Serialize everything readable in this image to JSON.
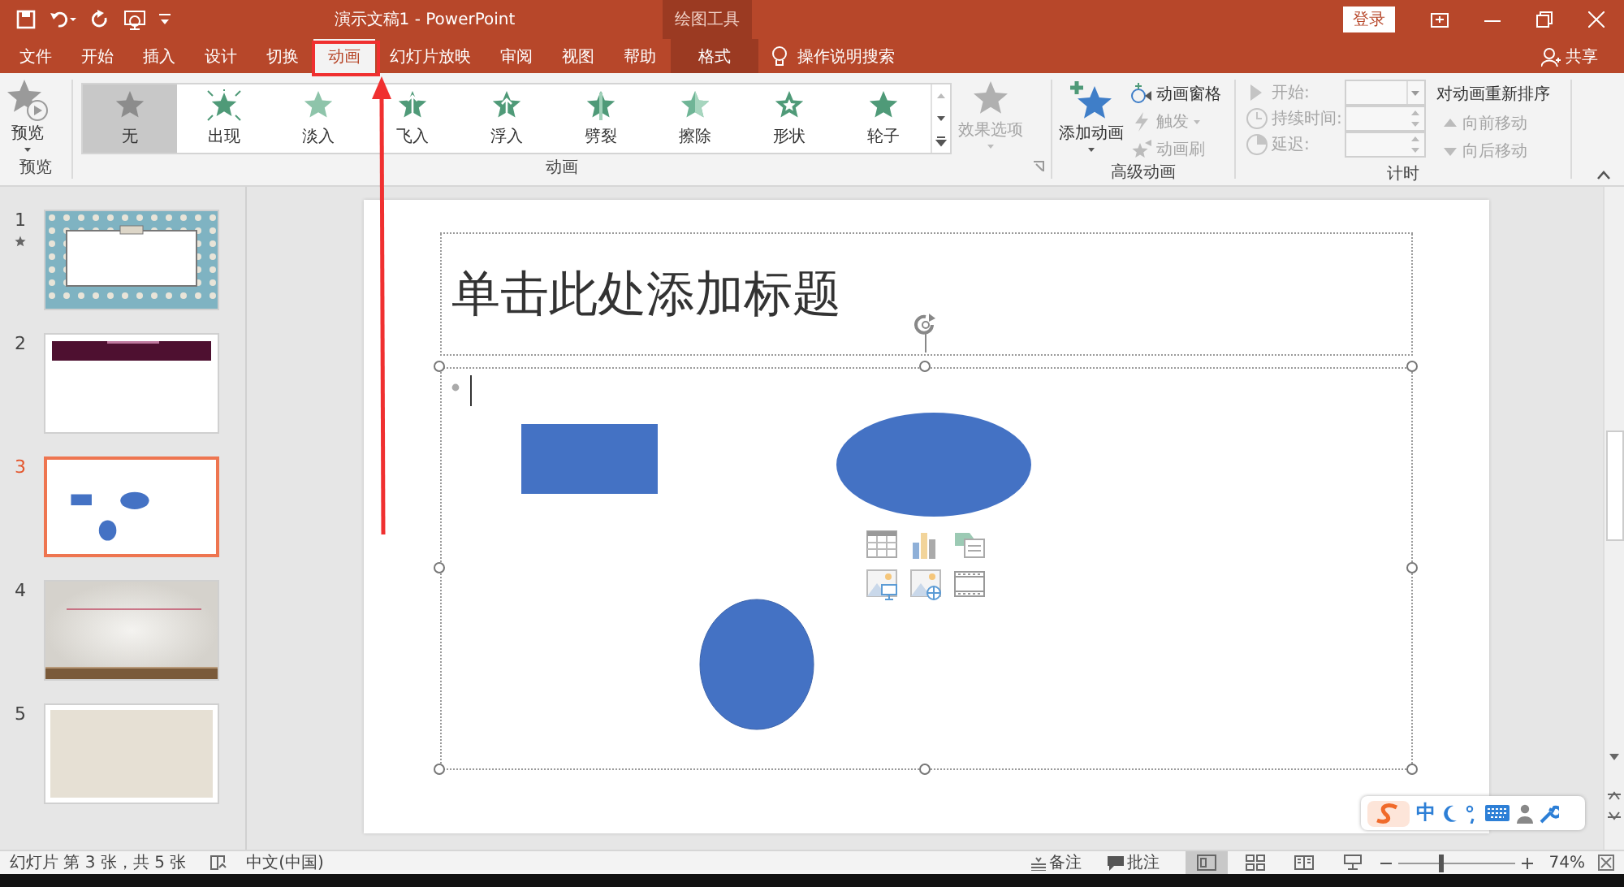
{
  "window": {
    "title": "演示文稿1  -  PowerPoint",
    "context_label": "绘图工具",
    "login": "登录"
  },
  "tabs": [
    {
      "label": "文件",
      "selected": false,
      "kind": "standard"
    },
    {
      "label": "开始",
      "selected": false,
      "kind": "standard"
    },
    {
      "label": "插入",
      "selected": false,
      "kind": "standard"
    },
    {
      "label": "设计",
      "selected": false,
      "kind": "standard"
    },
    {
      "label": "切换",
      "selected": false,
      "kind": "standard"
    },
    {
      "label": "动画",
      "selected": true,
      "kind": "standard"
    },
    {
      "label": "幻灯片放映",
      "selected": false,
      "kind": "standard"
    },
    {
      "label": "审阅",
      "selected": false,
      "kind": "standard"
    },
    {
      "label": "视图",
      "selected": false,
      "kind": "standard"
    },
    {
      "label": "帮助",
      "selected": false,
      "kind": "standard"
    },
    {
      "label": "格式",
      "selected": false,
      "kind": "contextual"
    }
  ],
  "tell_me": "操作说明搜索",
  "share": "共享",
  "ribbon": {
    "preview": {
      "label": "预览",
      "group_label": "预览"
    },
    "animations": {
      "items": [
        {
          "label": "无",
          "selected": true,
          "kind": "none"
        },
        {
          "label": "出现",
          "selected": false,
          "kind": "appear"
        },
        {
          "label": "淡入",
          "selected": false,
          "kind": "fade"
        },
        {
          "label": "飞入",
          "selected": false,
          "kind": "fly"
        },
        {
          "label": "浮入",
          "selected": false,
          "kind": "float"
        },
        {
          "label": "劈裂",
          "selected": false,
          "kind": "split"
        },
        {
          "label": "擦除",
          "selected": false,
          "kind": "wipe"
        },
        {
          "label": "形状",
          "selected": false,
          "kind": "shape"
        },
        {
          "label": "轮子",
          "selected": false,
          "kind": "wheel"
        }
      ],
      "effect_options": {
        "label": "效果选项",
        "disabled": true
      },
      "group_label": "动画"
    },
    "advanced": {
      "add_animation": "添加动画",
      "commands": [
        {
          "label": "动画窗格",
          "disabled": false,
          "kind": "pane"
        },
        {
          "label": "触发",
          "disabled": true,
          "kind": "trigger"
        },
        {
          "label": "动画刷",
          "disabled": true,
          "kind": "painter"
        }
      ],
      "group_label": "高级动画"
    },
    "timing": {
      "fields": [
        {
          "label": "开始:",
          "kind": "dropdown",
          "disabled": true
        },
        {
          "label": "持续时间:",
          "kind": "spinner",
          "disabled": true
        },
        {
          "label": "延迟:",
          "kind": "spinner",
          "disabled": true
        }
      ],
      "reorder_title": "对动画重新排序",
      "reorder": [
        {
          "label": "向前移动",
          "disabled": true,
          "kind": "up"
        },
        {
          "label": "向后移动",
          "disabled": true,
          "kind": "down"
        }
      ],
      "group_label": "计时"
    }
  },
  "slides": [
    {
      "number": "1",
      "selected": false,
      "has_animation": true,
      "kind": "pattern"
    },
    {
      "number": "2",
      "selected": false,
      "has_animation": false,
      "kind": "banner"
    },
    {
      "number": "3",
      "selected": true,
      "has_animation": false,
      "kind": "shapes"
    },
    {
      "number": "4",
      "selected": false,
      "has_animation": false,
      "kind": "stage"
    },
    {
      "number": "5",
      "selected": false,
      "has_animation": false,
      "kind": "plain"
    }
  ],
  "slide": {
    "title_placeholder": "单击此处添加标题"
  },
  "status_bar": {
    "slide_info": "幻灯片 第 3 张，共 5 张",
    "language": "中文(中国)",
    "notes": "备注",
    "comments": "批注",
    "views": [
      {
        "selected": true
      },
      {
        "selected": false
      },
      {
        "selected": false
      },
      {
        "selected": false
      }
    ],
    "zoom": {
      "level": 0.37,
      "reading": "74%"
    }
  },
  "ime": {
    "mode": "中"
  }
}
